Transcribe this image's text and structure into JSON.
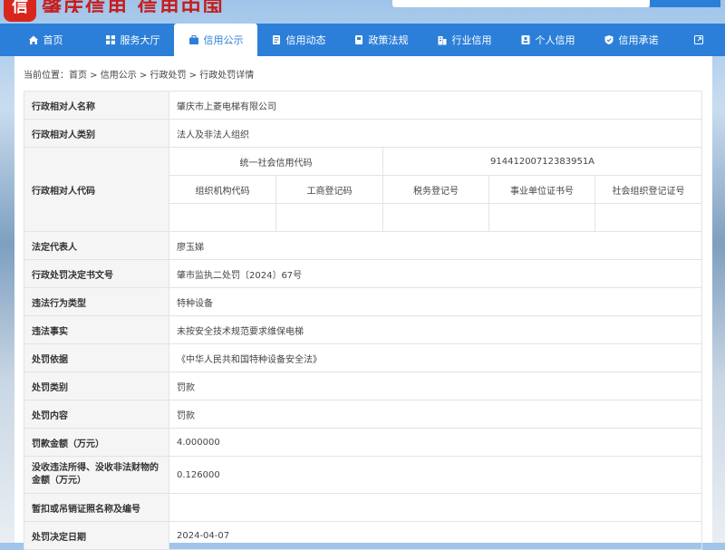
{
  "header": {
    "logo_glyph": "信",
    "title": "肇庆信用 信用中国"
  },
  "nav": {
    "items": [
      {
        "label": "首页",
        "icon": "home-icon"
      },
      {
        "label": "服务大厅",
        "icon": "grid-icon"
      },
      {
        "label": "信用公示",
        "icon": "briefcase-icon",
        "active": true
      },
      {
        "label": "信用动态",
        "icon": "document-icon"
      },
      {
        "label": "政策法规",
        "icon": "book-icon"
      },
      {
        "label": "行业信用",
        "icon": "building-icon"
      },
      {
        "label": "个人信用",
        "icon": "id-card-icon"
      },
      {
        "label": "信用承诺",
        "icon": "shield-icon"
      }
    ],
    "accent": "#2c7fd9"
  },
  "breadcrumb": {
    "prefix": "当前位置：",
    "items": [
      "首页",
      "信用公示",
      "行政处罚",
      "行政处罚详情"
    ],
    "separator": " > "
  },
  "detail": {
    "name_label": "行政相对人名称",
    "name_value": "肇庆市上菱电梯有限公司",
    "type_label": "行政相对人类别",
    "type_value": "法人及非法人组织",
    "code_label": "行政相对人代码",
    "uscc_label": "统一社会信用代码",
    "uscc_value": "91441200712383951A",
    "sub_headers": [
      "组织机构代码",
      "工商登记码",
      "税务登记号",
      "事业单位证书号",
      "社会组织登记证号"
    ],
    "sub_values": [
      "",
      "",
      "",
      "",
      ""
    ],
    "rows": [
      {
        "label": "法定代表人",
        "value": "廖玉娣"
      },
      {
        "label": "行政处罚决定书文号",
        "value": "肇市监执二处罚〔2024〕67号"
      },
      {
        "label": "违法行为类型",
        "value": "特种设备"
      },
      {
        "label": "违法事实",
        "value": "未按安全技术规范要求维保电梯"
      },
      {
        "label": "处罚依据",
        "value": "《中华人民共和国特种设备安全法》"
      },
      {
        "label": "处罚类别",
        "value": "罚款"
      },
      {
        "label": "处罚内容",
        "value": "罚款"
      },
      {
        "label": "罚款金额（万元）",
        "value": "4.000000"
      },
      {
        "label": "没收违法所得、没收非法财物的金额（万元）",
        "value": "0.126000"
      },
      {
        "label": "暂扣或吊销证照名称及编号",
        "value": ""
      },
      {
        "label": "处罚决定日期",
        "value": "2024-04-07"
      }
    ]
  }
}
